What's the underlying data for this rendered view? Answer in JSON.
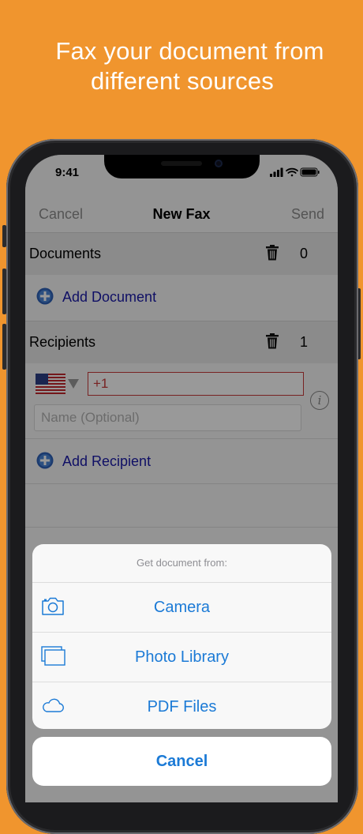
{
  "promo": {
    "line1": "Fax your document from",
    "line2": "different sources"
  },
  "status": {
    "time": "9:41"
  },
  "nav": {
    "cancel": "Cancel",
    "title": "New Fax",
    "send": "Send"
  },
  "documents": {
    "label": "Documents",
    "count": "0",
    "add_label": "Add Document"
  },
  "recipients": {
    "label": "Recipients",
    "count": "1",
    "phone_value": "+1",
    "name_placeholder": "Name (Optional)",
    "add_label": "Add Recipient"
  },
  "action_sheet": {
    "title": "Get document from:",
    "items": [
      {
        "label": "Camera",
        "icon": "camera-icon"
      },
      {
        "label": "Photo Library",
        "icon": "photo-library-icon"
      },
      {
        "label": "PDF Files",
        "icon": "cloud-icon"
      }
    ],
    "cancel": "Cancel"
  },
  "colors": {
    "background": "#F0952E",
    "accent": "#1b7ad6",
    "link": "#1a1aa8",
    "error": "#c93a3a"
  }
}
